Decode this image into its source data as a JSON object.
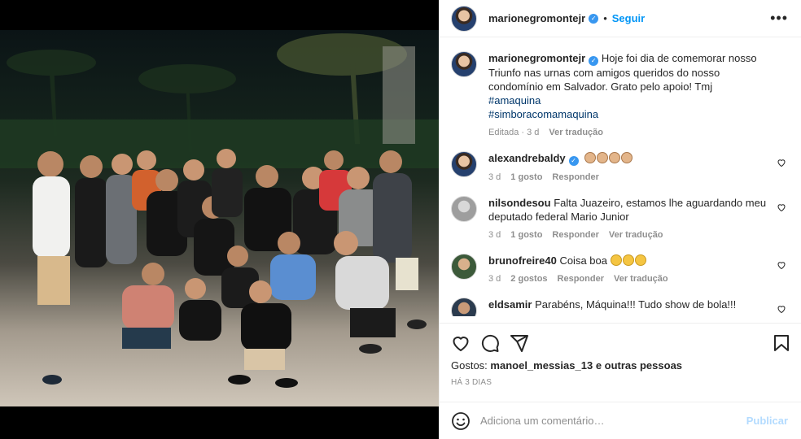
{
  "header": {
    "username": "marionegromontejr",
    "follow_label": "Seguir",
    "dot": "•"
  },
  "caption": {
    "username": "marionegromontejr",
    "text": "Hoje foi dia de comemorar nosso Triunfo nas urnas com amigos queridos do nosso condomínio em Salvador. Grato pelo apoio! Tmj",
    "hashtags": [
      "#amaquina",
      "#simboracomamaquina"
    ],
    "edited": "Editada · 3 d",
    "translate": "Ver tradução"
  },
  "comments": [
    {
      "username": "alexandrebaldy",
      "verified": true,
      "text": "",
      "emoji_count": 4,
      "time": "3 d",
      "likes": "1 gosto",
      "reply": "Responder",
      "translate": ""
    },
    {
      "username": "nilsondesou",
      "verified": false,
      "text": "Falta Juazeiro, estamos lhe aguardando meu deputado federal Mario Junior",
      "emoji_count": 0,
      "time": "3 d",
      "likes": "1 gosto",
      "reply": "Responder",
      "translate": "Ver tradução"
    },
    {
      "username": "brunofreire40",
      "verified": false,
      "text": "Coisa boa",
      "emoji_count": 3,
      "time": "3 d",
      "likes": "2 gostos",
      "reply": "Responder",
      "translate": "Ver tradução"
    },
    {
      "username": "eldsamir",
      "verified": false,
      "text": "Parabéns, Máquina!!! Tudo show de bola!!!",
      "emoji_count": 0,
      "time": "",
      "likes": "",
      "reply": "",
      "translate": ""
    }
  ],
  "likes": {
    "prefix": "Gostos:",
    "user": "manoel_messias_13",
    "suffix": "e outras pessoas"
  },
  "posted_ago": "HÁ 3 DIAS",
  "add_comment": {
    "placeholder": "Adiciona um comentário…",
    "publish_label": "Publicar"
  },
  "icons": {
    "more": "more-options-icon",
    "like": "heart-icon",
    "comment": "comment-icon",
    "share": "share-icon",
    "save": "bookmark-icon",
    "emoji": "emoji-icon"
  },
  "colors": {
    "accent": "#0095f6",
    "verified": "#3897f0",
    "hashtag": "#00376b",
    "muted": "#8e8e8e",
    "publish_disabled": "#b3dbff"
  }
}
